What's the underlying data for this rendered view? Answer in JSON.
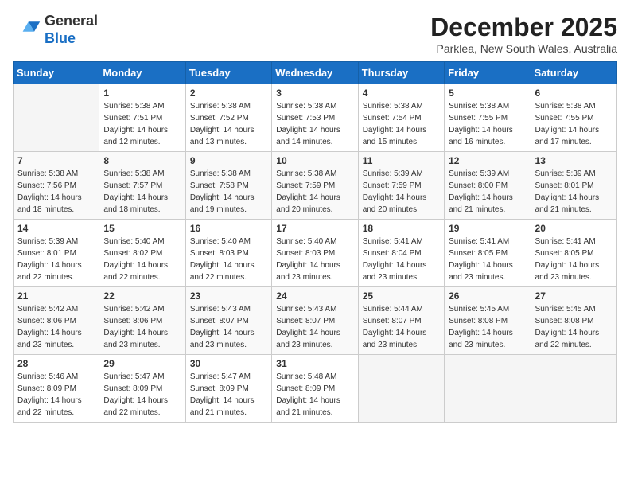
{
  "header": {
    "logo_general": "General",
    "logo_blue": "Blue",
    "month_title": "December 2025",
    "subtitle": "Parklea, New South Wales, Australia"
  },
  "weekdays": [
    "Sunday",
    "Monday",
    "Tuesday",
    "Wednesday",
    "Thursday",
    "Friday",
    "Saturday"
  ],
  "weeks": [
    [
      {
        "day": "",
        "sunrise": "",
        "sunset": "",
        "daylight": ""
      },
      {
        "day": "1",
        "sunrise": "5:38 AM",
        "sunset": "7:51 PM",
        "daylight": "14 hours and 12 minutes."
      },
      {
        "day": "2",
        "sunrise": "5:38 AM",
        "sunset": "7:52 PM",
        "daylight": "14 hours and 13 minutes."
      },
      {
        "day": "3",
        "sunrise": "5:38 AM",
        "sunset": "7:53 PM",
        "daylight": "14 hours and 14 minutes."
      },
      {
        "day": "4",
        "sunrise": "5:38 AM",
        "sunset": "7:54 PM",
        "daylight": "14 hours and 15 minutes."
      },
      {
        "day": "5",
        "sunrise": "5:38 AM",
        "sunset": "7:55 PM",
        "daylight": "14 hours and 16 minutes."
      },
      {
        "day": "6",
        "sunrise": "5:38 AM",
        "sunset": "7:55 PM",
        "daylight": "14 hours and 17 minutes."
      }
    ],
    [
      {
        "day": "7",
        "sunrise": "5:38 AM",
        "sunset": "7:56 PM",
        "daylight": "14 hours and 18 minutes."
      },
      {
        "day": "8",
        "sunrise": "5:38 AM",
        "sunset": "7:57 PM",
        "daylight": "14 hours and 18 minutes."
      },
      {
        "day": "9",
        "sunrise": "5:38 AM",
        "sunset": "7:58 PM",
        "daylight": "14 hours and 19 minutes."
      },
      {
        "day": "10",
        "sunrise": "5:38 AM",
        "sunset": "7:59 PM",
        "daylight": "14 hours and 20 minutes."
      },
      {
        "day": "11",
        "sunrise": "5:39 AM",
        "sunset": "7:59 PM",
        "daylight": "14 hours and 20 minutes."
      },
      {
        "day": "12",
        "sunrise": "5:39 AM",
        "sunset": "8:00 PM",
        "daylight": "14 hours and 21 minutes."
      },
      {
        "day": "13",
        "sunrise": "5:39 AM",
        "sunset": "8:01 PM",
        "daylight": "14 hours and 21 minutes."
      }
    ],
    [
      {
        "day": "14",
        "sunrise": "5:39 AM",
        "sunset": "8:01 PM",
        "daylight": "14 hours and 22 minutes."
      },
      {
        "day": "15",
        "sunrise": "5:40 AM",
        "sunset": "8:02 PM",
        "daylight": "14 hours and 22 minutes."
      },
      {
        "day": "16",
        "sunrise": "5:40 AM",
        "sunset": "8:03 PM",
        "daylight": "14 hours and 22 minutes."
      },
      {
        "day": "17",
        "sunrise": "5:40 AM",
        "sunset": "8:03 PM",
        "daylight": "14 hours and 23 minutes."
      },
      {
        "day": "18",
        "sunrise": "5:41 AM",
        "sunset": "8:04 PM",
        "daylight": "14 hours and 23 minutes."
      },
      {
        "day": "19",
        "sunrise": "5:41 AM",
        "sunset": "8:05 PM",
        "daylight": "14 hours and 23 minutes."
      },
      {
        "day": "20",
        "sunrise": "5:41 AM",
        "sunset": "8:05 PM",
        "daylight": "14 hours and 23 minutes."
      }
    ],
    [
      {
        "day": "21",
        "sunrise": "5:42 AM",
        "sunset": "8:06 PM",
        "daylight": "14 hours and 23 minutes."
      },
      {
        "day": "22",
        "sunrise": "5:42 AM",
        "sunset": "8:06 PM",
        "daylight": "14 hours and 23 minutes."
      },
      {
        "day": "23",
        "sunrise": "5:43 AM",
        "sunset": "8:07 PM",
        "daylight": "14 hours and 23 minutes."
      },
      {
        "day": "24",
        "sunrise": "5:43 AM",
        "sunset": "8:07 PM",
        "daylight": "14 hours and 23 minutes."
      },
      {
        "day": "25",
        "sunrise": "5:44 AM",
        "sunset": "8:07 PM",
        "daylight": "14 hours and 23 minutes."
      },
      {
        "day": "26",
        "sunrise": "5:45 AM",
        "sunset": "8:08 PM",
        "daylight": "14 hours and 23 minutes."
      },
      {
        "day": "27",
        "sunrise": "5:45 AM",
        "sunset": "8:08 PM",
        "daylight": "14 hours and 22 minutes."
      }
    ],
    [
      {
        "day": "28",
        "sunrise": "5:46 AM",
        "sunset": "8:09 PM",
        "daylight": "14 hours and 22 minutes."
      },
      {
        "day": "29",
        "sunrise": "5:47 AM",
        "sunset": "8:09 PM",
        "daylight": "14 hours and 22 minutes."
      },
      {
        "day": "30",
        "sunrise": "5:47 AM",
        "sunset": "8:09 PM",
        "daylight": "14 hours and 21 minutes."
      },
      {
        "day": "31",
        "sunrise": "5:48 AM",
        "sunset": "8:09 PM",
        "daylight": "14 hours and 21 minutes."
      },
      {
        "day": "",
        "sunrise": "",
        "sunset": "",
        "daylight": ""
      },
      {
        "day": "",
        "sunrise": "",
        "sunset": "",
        "daylight": ""
      },
      {
        "day": "",
        "sunrise": "",
        "sunset": "",
        "daylight": ""
      }
    ]
  ]
}
